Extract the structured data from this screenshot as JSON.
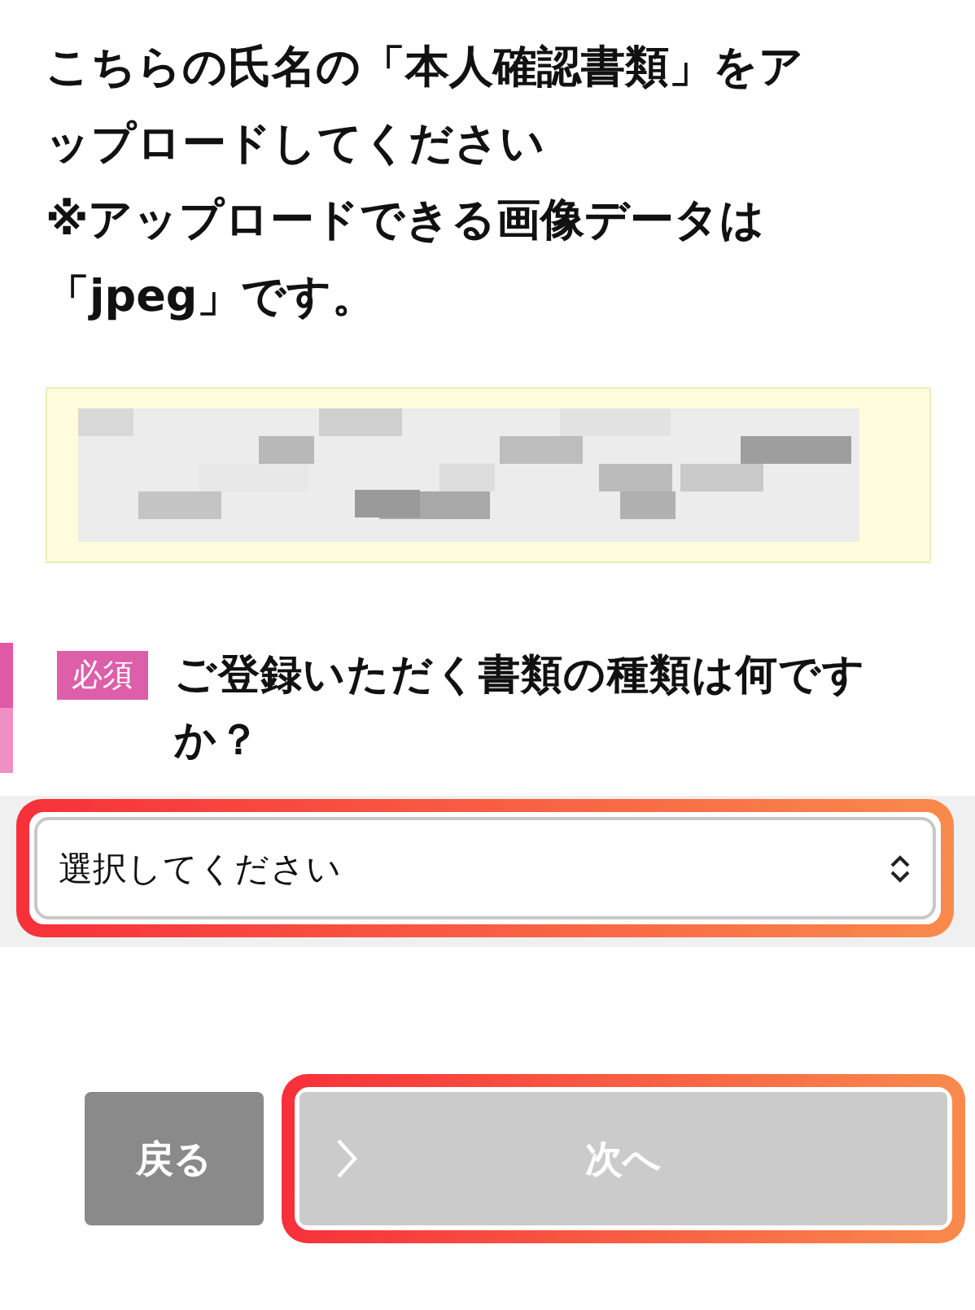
{
  "instructions": {
    "lines": [
      "こちらの氏名の「本人確認書類」をア",
      "ップロードしてください",
      "※アップロードできる画像データは",
      "「jpeg」です。"
    ]
  },
  "question": {
    "required_badge": "必須",
    "text": "ご登録いただく書類の種類は何ですか？"
  },
  "select": {
    "value": "選択してください",
    "highlighted": true
  },
  "buttons": [
    {
      "kind": "back",
      "label": "戻る",
      "highlighted": false
    },
    {
      "kind": "next",
      "label": "次へ",
      "highlighted": true
    }
  ]
}
